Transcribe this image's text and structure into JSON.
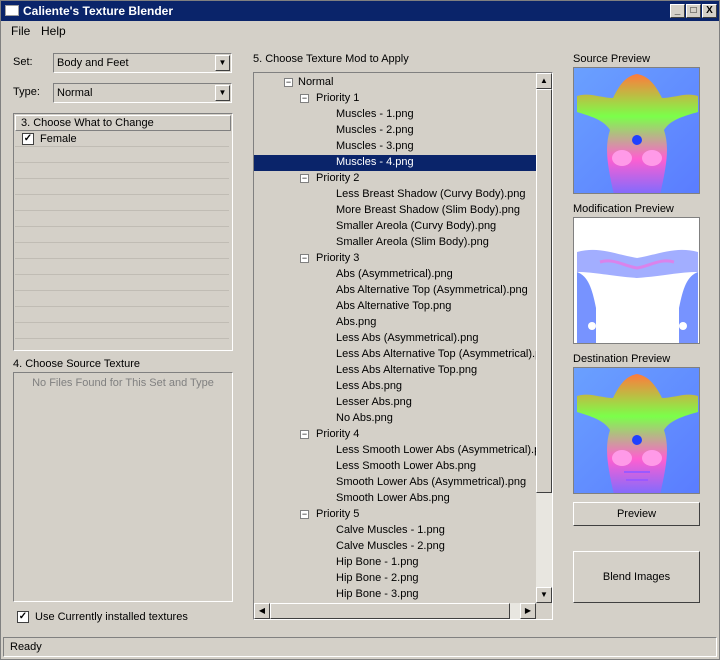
{
  "window": {
    "title": "Caliente's Texture Blender",
    "minimize": "_",
    "maximize": "□",
    "close": "X"
  },
  "menu": {
    "file": "File",
    "help": "Help"
  },
  "set": {
    "label": "Set:",
    "value": "Body and Feet"
  },
  "type": {
    "label": "Type:",
    "value": "Normal"
  },
  "change_panel": {
    "header": "3. Choose What to Change",
    "items": [
      {
        "label": "Female",
        "checked": true
      }
    ]
  },
  "source_panel": {
    "header": "4. Choose Source Texture",
    "empty_text": "No Files Found for This Set and Type"
  },
  "use_installed": {
    "label": "Use Currently installed textures",
    "checked": true
  },
  "mod_panel": {
    "header": "5. Choose Texture Mod to Apply",
    "root": "Normal",
    "selected": "Muscles - 4.png",
    "groups": [
      {
        "name": "Priority 1",
        "items": [
          "Muscles - 1.png",
          "Muscles - 2.png",
          "Muscles - 3.png",
          "Muscles - 4.png"
        ]
      },
      {
        "name": "Priority 2",
        "items": [
          "Less Breast Shadow (Curvy Body).png",
          "More Breast Shadow (Slim Body).png",
          "Smaller Areola (Curvy Body).png",
          "Smaller Areola (Slim Body).png"
        ]
      },
      {
        "name": "Priority 3",
        "items": [
          "Abs (Asymmetrical).png",
          "Abs Alternative Top (Asymmetrical).png",
          "Abs Alternative Top.png",
          "Abs.png",
          "Less Abs (Asymmetrical).png",
          "Less Abs Alternative Top (Asymmetrical).p",
          "Less Abs Alternative Top.png",
          "Less Abs.png",
          "Lesser Abs.png",
          "No Abs.png"
        ]
      },
      {
        "name": "Priority 4",
        "items": [
          "Less Smooth Lower Abs (Asymmetrical).pn",
          "Less Smooth Lower Abs.png",
          "Smooth Lower Abs (Asymmetrical).png",
          "Smooth Lower Abs.png"
        ]
      },
      {
        "name": "Priority 5",
        "items": [
          "Calve Muscles - 1.png",
          "Calve Muscles - 2.png",
          "Hip Bone - 1.png",
          "Hip Bone - 2.png",
          "Hip Bone - 3.png"
        ]
      }
    ]
  },
  "previews": {
    "source": "Source Preview",
    "modification": "Modification Preview",
    "destination": "Destination Preview"
  },
  "buttons": {
    "preview": "Preview",
    "blend": "Blend Images"
  },
  "status": "Ready"
}
